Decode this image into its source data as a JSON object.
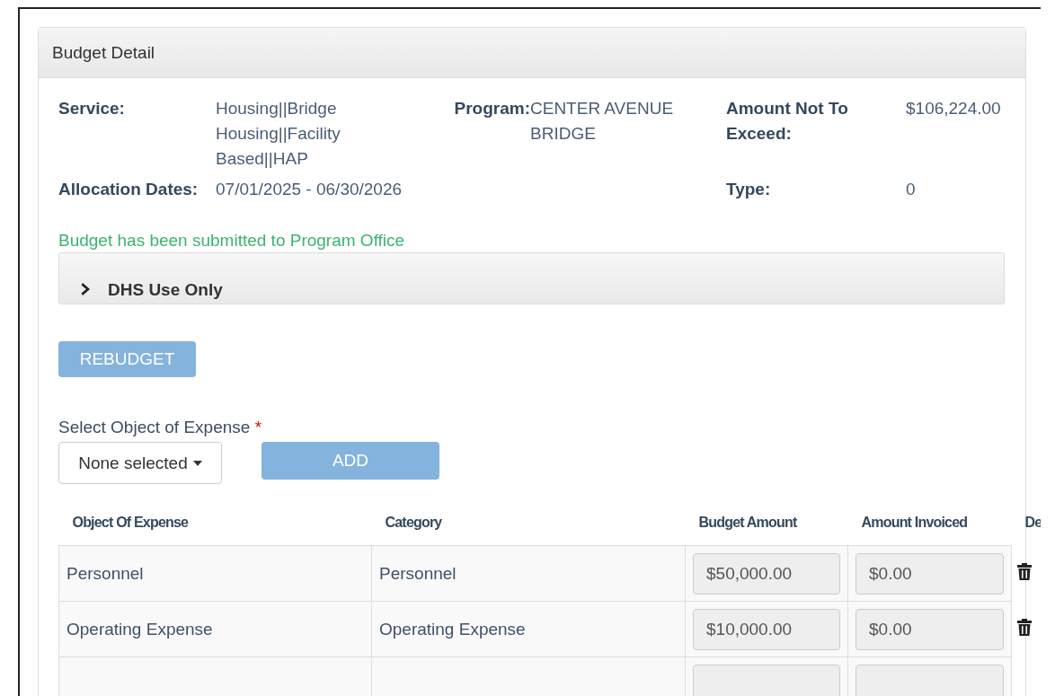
{
  "panel": {
    "title": "Budget Detail"
  },
  "details": [
    {
      "label": "Service:",
      "value": "Housing||Bridge Housing||Facility Based||HAP"
    },
    {
      "label": "Program:",
      "value": "CENTER AVENUE BRIDGE"
    },
    {
      "label": "Amount Not To Exceed:",
      "value": "$106,224.00"
    },
    {
      "label": "Allocation Dates:",
      "value": "07/01/2025 - 06/30/2026"
    },
    {
      "label": "Type:",
      "value": "0"
    }
  ],
  "status_message": "Budget has been submitted to Program Office",
  "accordion": {
    "title": "DHS Use Only",
    "expanded": false
  },
  "rebudget_button": {
    "label": "REBUDGET",
    "disabled": true
  },
  "expense_select": {
    "label": "Select Object of Expense",
    "required_mark": "*",
    "value": "None selected"
  },
  "add_button": {
    "label": "ADD",
    "disabled": true
  },
  "table": {
    "columns": [
      "Object Of Expense",
      "Category",
      "Budget Amount",
      "Amount Invoiced",
      "De"
    ],
    "rows": [
      {
        "kind": "item",
        "object": "Personnel",
        "category": "Personnel",
        "budget": "$50,000.00",
        "invoiced": "$0.00"
      },
      {
        "kind": "item",
        "object": "Operating Expense",
        "category": "Operating Expense",
        "budget": "$10,000.00",
        "invoiced": "$0.00"
      },
      {
        "kind": "blank"
      }
    ]
  }
}
